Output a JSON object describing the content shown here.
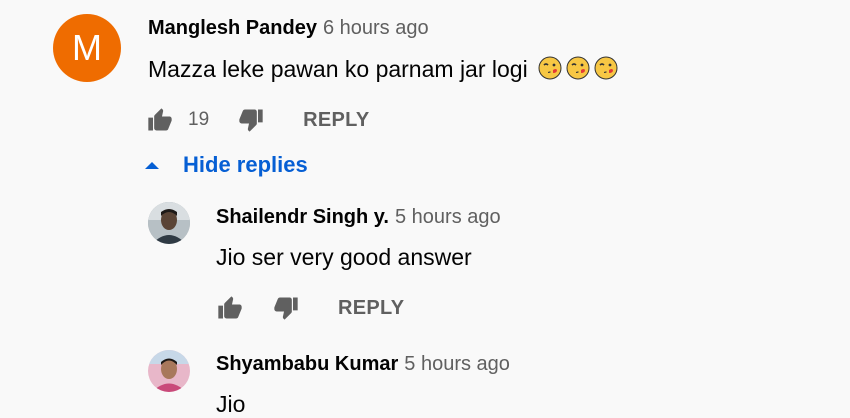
{
  "comments": [
    {
      "avatar_letter": "M",
      "author": "Manglesh Pandey",
      "time": "6 hours ago",
      "text": "Mazza leke pawan ko parnam jar logi",
      "emojis": [
        "face-blowing-kiss-icon",
        "face-blowing-kiss-icon",
        "face-blowing-kiss-icon"
      ],
      "likes": "19",
      "reply_label": "REPLY"
    }
  ],
  "hide_replies_label": "Hide replies",
  "replies": [
    {
      "author": "Shailendr Singh y.",
      "time": "5 hours ago",
      "text": "Jio ser very good answer",
      "reply_label": "REPLY"
    },
    {
      "author": "Shyambabu Kumar",
      "time": "5 hours ago",
      "text": "Jio"
    }
  ],
  "colors": {
    "link_blue": "#065fd4",
    "avatar_orange": "#ef6c00",
    "muted_text": "#606060"
  }
}
